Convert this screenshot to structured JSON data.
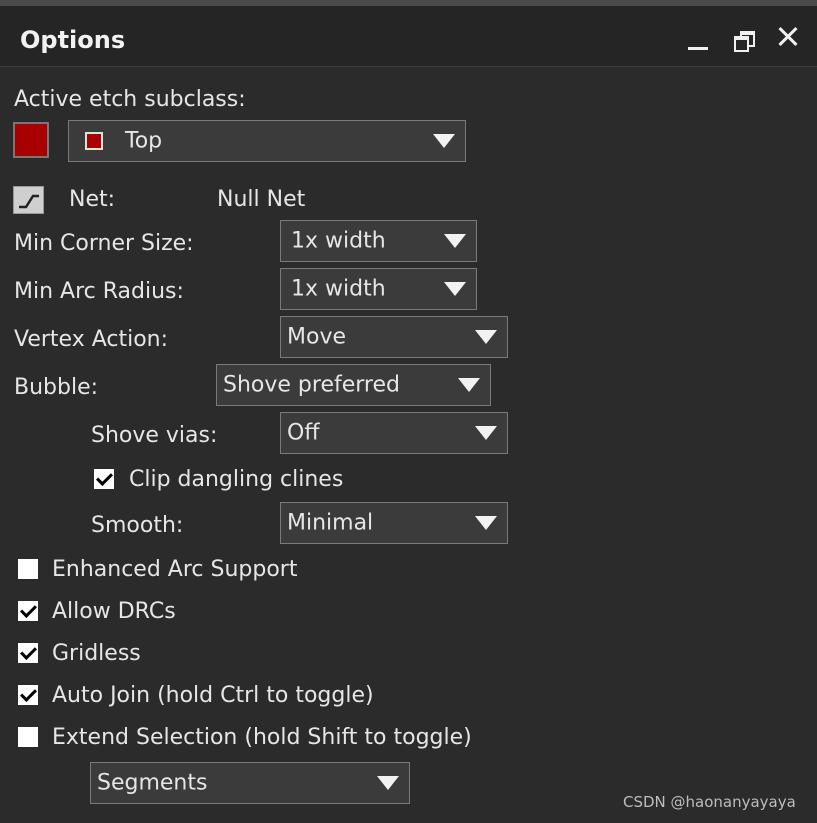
{
  "panel": {
    "title": "Options",
    "controls": [
      "minimize-icon",
      "float-icon",
      "close-icon"
    ]
  },
  "etch": {
    "label": "Active etch subclass:",
    "swatch_color": "#a80000",
    "value": "Top"
  },
  "net": {
    "label": "Net:",
    "value": "Null Net"
  },
  "min_corner": {
    "label": "Min Corner Size:",
    "value": "1x width"
  },
  "min_arc": {
    "label": "Min Arc Radius:",
    "value": "1x width"
  },
  "vertex_action": {
    "label": "Vertex Action:",
    "value": "Move"
  },
  "bubble": {
    "label": "Bubble:",
    "value": "Shove preferred"
  },
  "shove_vias": {
    "label": "Shove vias:",
    "value": "Off"
  },
  "clip_dangling": {
    "label": "Clip dangling clines",
    "checked": true
  },
  "smooth": {
    "label": "Smooth:",
    "value": "Minimal"
  },
  "checkboxes": [
    {
      "label": "Enhanced Arc Support",
      "checked": false
    },
    {
      "label": "Allow DRCs",
      "checked": true
    },
    {
      "label": "Gridless",
      "checked": true
    },
    {
      "label": "Auto Join (hold Ctrl to toggle)",
      "checked": true
    },
    {
      "label": "Extend Selection (hold Shift to toggle)",
      "checked": false
    }
  ],
  "extend_mode": {
    "value": "Segments"
  },
  "watermark": "CSDN @haonanyayaya"
}
